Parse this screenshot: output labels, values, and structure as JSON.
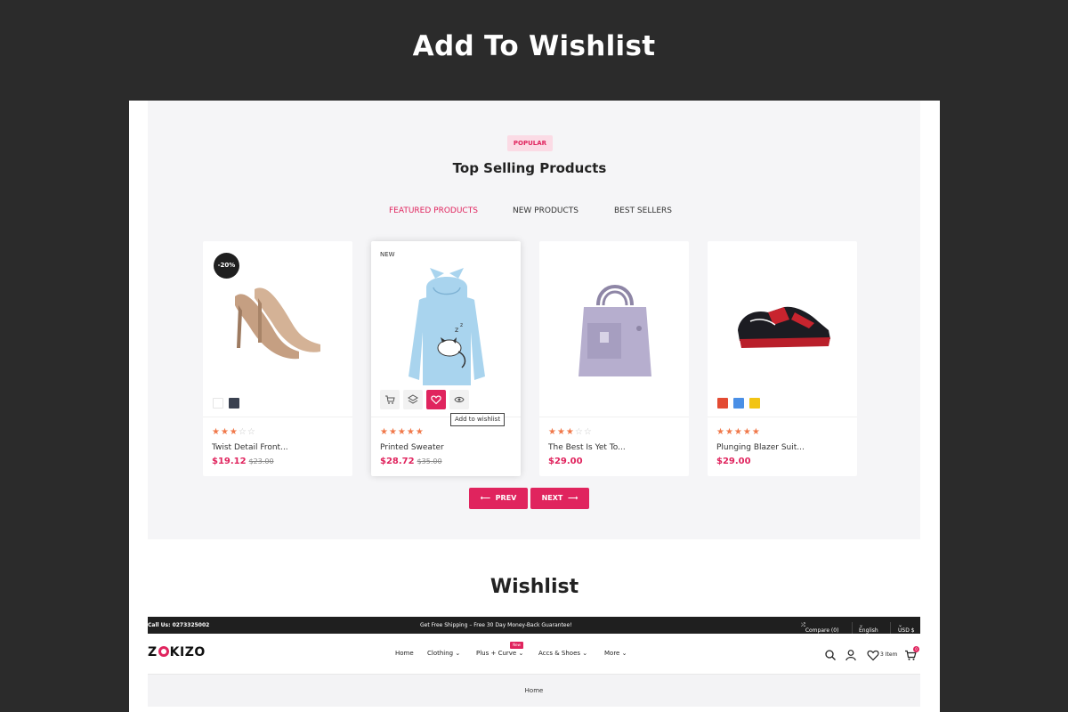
{
  "banner": {
    "title": "Add To Wishlist"
  },
  "section": {
    "badge": "POPULAR",
    "title": "Top Selling Products",
    "tabs": [
      "FEATURED PRODUCTS",
      "NEW PRODUCTS",
      "BEST SELLERS"
    ]
  },
  "products": [
    {
      "tag": "-20%",
      "name": "Twist Detail Front...",
      "price": "$19.12",
      "old_price": "$23.00",
      "rating": 3,
      "swatches": [
        "#ffffff",
        "#3a4150"
      ]
    },
    {
      "tag": "NEW",
      "name": "Printed Sweater",
      "price": "$28.72",
      "old_price": "$35.00",
      "rating": 5,
      "swatches": []
    },
    {
      "tag": "",
      "name": "The Best Is Yet To...",
      "price": "$29.00",
      "old_price": "",
      "rating": 3,
      "swatches": []
    },
    {
      "tag": "",
      "name": "Plunging Blazer Suit...",
      "price": "$29.00",
      "old_price": "",
      "rating": 5,
      "swatches": [
        "#e34b33",
        "#4a8fe6",
        "#f2c413"
      ]
    }
  ],
  "actions": {
    "cart_icon": "cart-icon",
    "compare_icon": "layers-icon",
    "wishlist_icon": "heart-icon",
    "quickview_icon": "eye-icon",
    "tooltip": "Add to wishlist"
  },
  "pager": {
    "prev": "PREV",
    "next": "NEXT",
    "prev_arrow": "⟵",
    "next_arrow": "⟶"
  },
  "wishlist": {
    "title": "Wishlist"
  },
  "site": {
    "topbar": {
      "call": "Call Us: 0273325002",
      "shipping": "Get Free Shipping – Free 30 Day Money-Back Guarantee!",
      "compare": "Compare (0)",
      "language": "English",
      "currency": "USD $"
    },
    "logo": {
      "left": "Z",
      "right": "KIZO"
    },
    "nav": {
      "items": [
        "Home",
        "Clothing",
        "Plus + Curve",
        "Accs & Shoes",
        "More"
      ],
      "new_label": "New"
    },
    "cart_items": "3 Item",
    "cart_count": "0",
    "breadcrumb": "Home"
  },
  "colors": {
    "accent": "#e0245e",
    "star": "#f0784a",
    "dark": "#2b2b2b"
  }
}
